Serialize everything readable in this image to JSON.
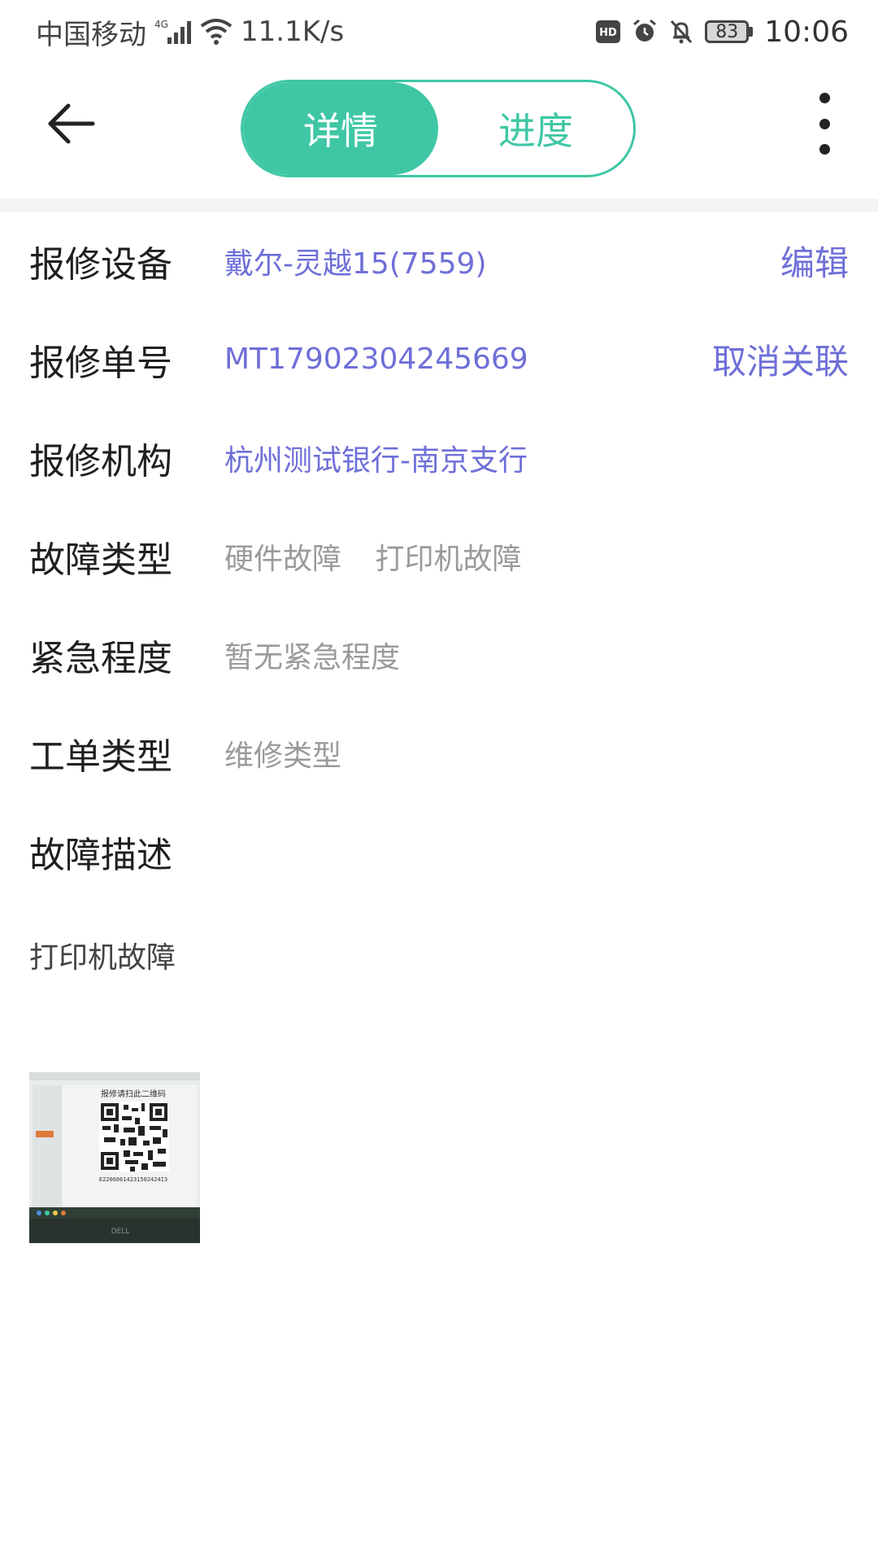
{
  "status_bar": {
    "carrier": "中国移动",
    "network_type": "4G",
    "speed": "11.1K/s",
    "hd_badge": "HD",
    "battery": "83",
    "time": "10:06",
    "icons": [
      "signal-icon",
      "wifi-icon",
      "alarm-icon",
      "mute-bell-icon",
      "battery-icon"
    ]
  },
  "header": {
    "tabs": [
      {
        "label": "详情",
        "active": true
      },
      {
        "label": "进度",
        "active": false
      }
    ]
  },
  "colors": {
    "accent": "#3fc7a5",
    "link": "#6e6fd8",
    "muted": "#9a9a9a",
    "label": "#1f1f1f"
  },
  "details": {
    "device": {
      "label": "报修设备",
      "value": "戴尔-灵越15(7559)",
      "action": "编辑"
    },
    "order_no": {
      "label": "报修单号",
      "value": "MT17902304245669",
      "action": "取消关联"
    },
    "organization": {
      "label": "报修机构",
      "value": "杭州测试银行-南京支行"
    },
    "fault_type": {
      "label": "故障类型",
      "values": [
        "硬件故障",
        "打印机故障"
      ]
    },
    "urgency": {
      "label": "紧急程度",
      "value": "暂无紧急程度"
    },
    "order_type": {
      "label": "工单类型",
      "value": "维修类型"
    },
    "description": {
      "label": "故障描述",
      "value": "打印机故障"
    }
  },
  "attachment": {
    "photo_caption": "报修请扫此二维码",
    "photo_code": "E22060614231502424I3",
    "photo_brand": "DELL"
  }
}
